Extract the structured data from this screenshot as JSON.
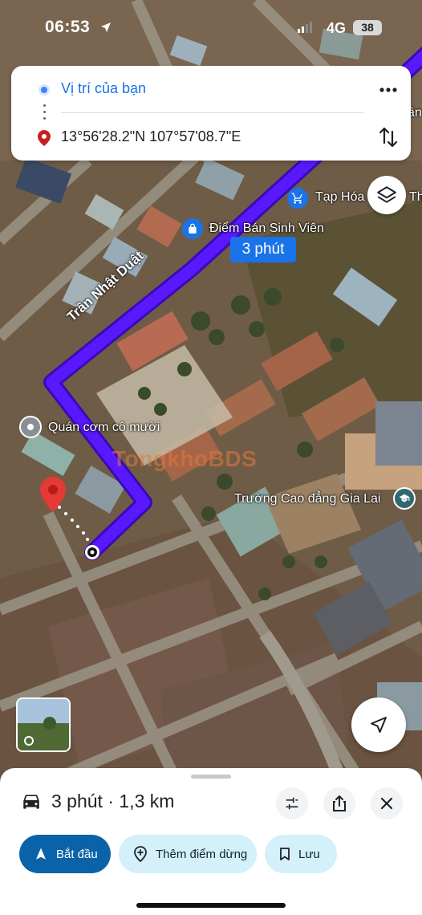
{
  "status_bar": {
    "time": "06:53",
    "network": "4G",
    "battery": "38"
  },
  "directions": {
    "origin": "Vị trí của bạn",
    "destination": "13°56'28.2\"N 107°57'08.7\"E"
  },
  "map": {
    "road_label": "Trần Nhật Duật",
    "eta_badge": "3 phút",
    "places": [
      {
        "name": "Tạp Hóa",
        "name_cut": "Th"
      },
      {
        "name": "Điểm Bán Sinh Viên"
      },
      {
        "name": "Quán cơm cô mười"
      },
      {
        "name": "Trường Cao đẳng Gia Lai"
      }
    ],
    "top_right_fragment": "ân",
    "watermark": "TongkhoBDS",
    "route_color": "#5a18ff"
  },
  "sheet": {
    "summary": "3 phút · 1,3 km",
    "start_label": "Bắt đầu",
    "add_stop_label": "Thêm điểm dừng",
    "save_label": "Lưu"
  },
  "colors": {
    "accent_blue": "#1a73e8",
    "start_button": "#0a63a8",
    "chip_bg": "#d3f0fb"
  }
}
